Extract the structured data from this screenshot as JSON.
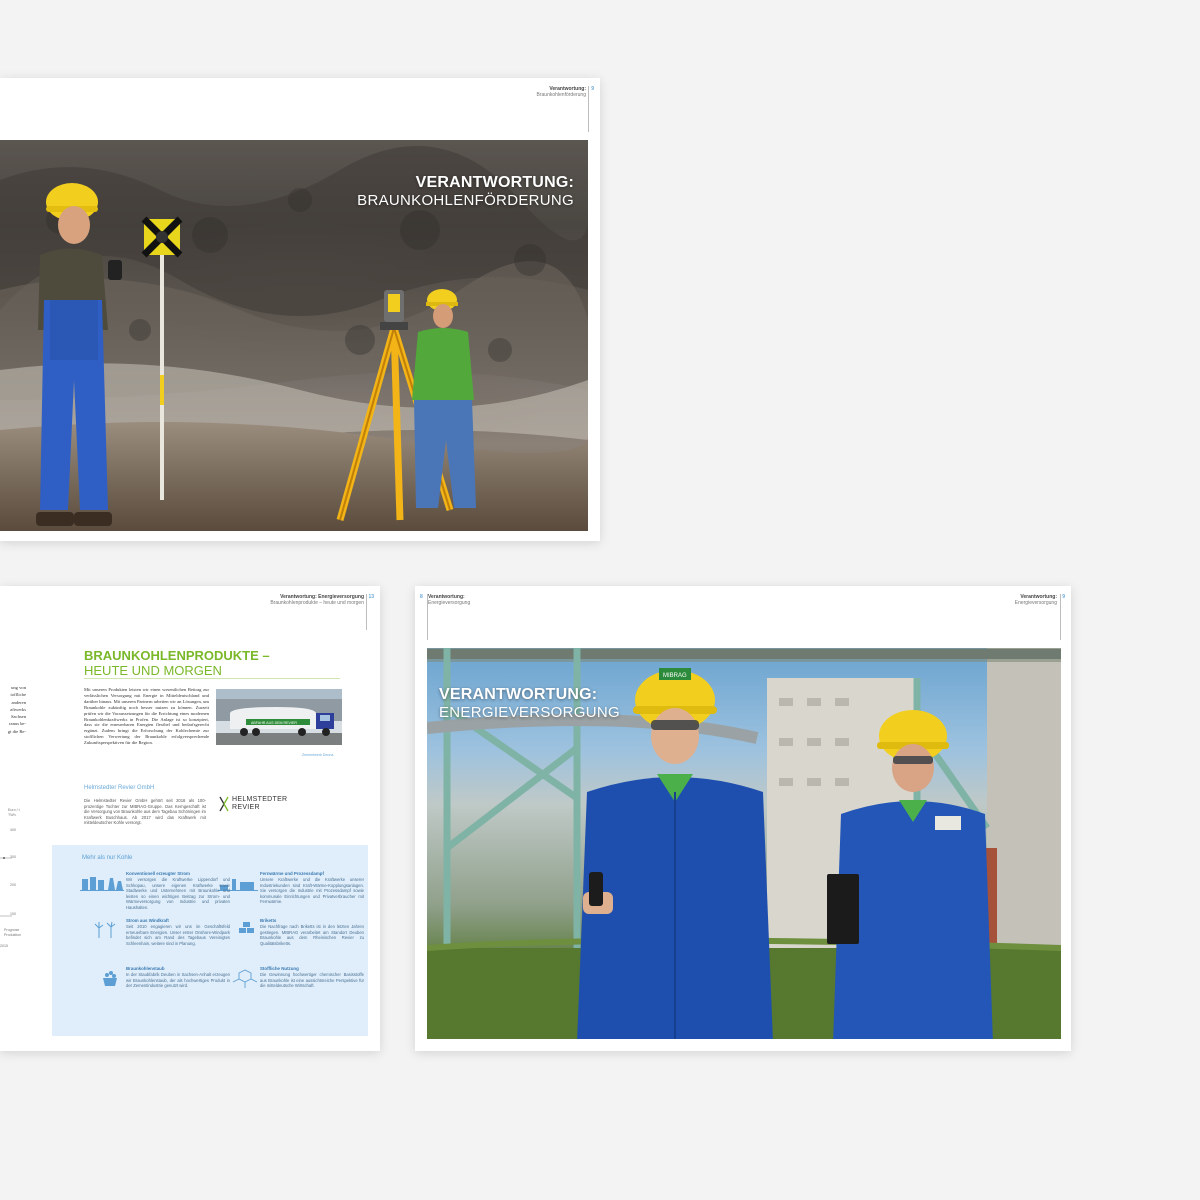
{
  "page_top": {
    "header_title": "Verantwortung:",
    "header_subtitle": "Braunkohlenförderung",
    "page_number": "9",
    "headline_bold": "VERANTWORTUNG:",
    "headline_light": "BRAUNKOHLENFÖRDERUNG"
  },
  "page_left": {
    "header_title": "Verantwortung: Energieversorgung",
    "header_subtitle": "Braunkohlenprodukte – heute und morgen",
    "page_number": "13",
    "section_title_1": "BRAUNKOHLENPRODUKTE –",
    "section_title_2": "HEUTE UND MORGEN",
    "body_text": "Mit unseren Produkten leisten wir einen wesentlichen Beitrag zur verlässlichen Versorgung mit Energie in Mitteldeutschland und darüber hinaus. Mit unseren Partnern arbeiten wir an Lösungen, um Braunkohle zukünftig noch besser nutzen zu können. Zurzeit prüfen wir die Voraussetzungen für die Errichtung eines modernen Braunkohlenkraftwerks in Profen. Die Anlage ist so konzipiert, dass sie die erneuerbaren Energien flexibel und bedarfsgerecht ergänzt. Zudem bringt die Erforschung der Kohlechemie zur stofflichen Verwertung der Braunkohle erfolgversprechende Zukunftsperspektiven für die Region.",
    "cut_text_lines": [
      "ung von",
      "toffliche",
      "anderen",
      "aftwerks",
      "Sachsen",
      "ranus be-",
      "gt die Re-"
    ],
    "truck_label": "ABFAHR AUS DEM REVIER",
    "image_caption": "Zementwerk Deuna",
    "subsection_title": "Helmstedter Revier GmbH",
    "subsection_text": "Die Helmstedter Revier GmbH gehört seit 2016 als 100-prozentige Tochter zur MIBRAG-Gruppe. Das Kerngeschäft ist die Versorgung von Braunkohle aus dem Tagebau Schöningen im Kraftwerk Buschhaus. Ab 2017 wird das Kraftwerk mit mitteldeutscher Kohle versorgt.",
    "logo_text_1": "HELMSTEDTER",
    "logo_text_2": "REVIER",
    "axis_labels": [
      "Euro / t",
      "TWh",
      "400",
      "300",
      "200",
      "100",
      "Prognose",
      "Produktion",
      "2015"
    ],
    "box_title": "Mehr als nur Kohle",
    "items": [
      {
        "icon": "power-plant-icon",
        "title": "Konventionell erzeugter Strom",
        "text": "Wir versorgen die Kraftwerke Lippendorf und Schkopau, unsere eigenen Kraftwerke sowie Stadtwerke und Unternehmen mit Braunkohle und leisten so einen wichtigen Beitrag zur Strom- und Wärmeversorgung von Industrie und privaten Haushalten."
      },
      {
        "icon": "district-heating-icon",
        "title": "Fernwärme und Prozessdampf",
        "text": "Unsere Kraftwerke und die Kraftwerke unserer Industriekunden sind Kraft-Wärme-Kopplungsanlagen. Sie versorgen die Industrie mit Prozessdampf sowie kommunale Einrichtungen und Privatverbraucher mit Fernwärme."
      },
      {
        "icon": "wind-turbine-icon",
        "title": "Strom aus Windkraft",
        "text": "Seit 2010 engagieren wir uns im Geschäftsfeld erneuerbare Energien. Unser erster Onshore-Windpark befindet sich am Rand des Tagebaus Vereinigtes Schleenhain, weitere sind in Planung."
      },
      {
        "icon": "briquette-icon",
        "title": "Briketts",
        "text": "Die Nachfrage nach Briketts ist in den letzten Jahren gestiegen. MIBRAG verarbeitet am Standort Deuben Braunkohle aus dem Rheinischen Revier zu Qualitätsbriketts."
      },
      {
        "icon": "coal-dust-icon",
        "title": "Braunkohlenstaub",
        "text": "In der Staubfabrik Deuben in Sachsen-Anhalt erzeugen wir Braunkohlenstaub, der als hochwertiges Produkt in der Zementindustrie genutzt wird."
      },
      {
        "icon": "molecule-icon",
        "title": "Stoffliche Nutzung",
        "text": "Die Gewinnung hochwertiger chemischer Basisstoffe aus Braunkohle ist eine aussichtsreiche Perspektive für die mitteldeutsche Wirtschaft."
      }
    ]
  },
  "page_right": {
    "page_number_left": "8",
    "header_left_title": "Verantwortung:",
    "header_left_subtitle": "Energieversorgung",
    "header_right_title": "Verantwortung:",
    "header_right_subtitle": "Energieversorgung",
    "page_number_right": "9",
    "headline_bold": "VERANTWORTUNG:",
    "headline_light": "ENERGIEVERSORGUNG",
    "helmet_text": "MIBRAG"
  },
  "colors": {
    "accent_green": "#7ab829",
    "accent_blue": "#5d9fd4",
    "box_blue": "#dfeefa",
    "helmet_yellow": "#f2cf1e",
    "workwear_blue": "#1f4fae"
  }
}
